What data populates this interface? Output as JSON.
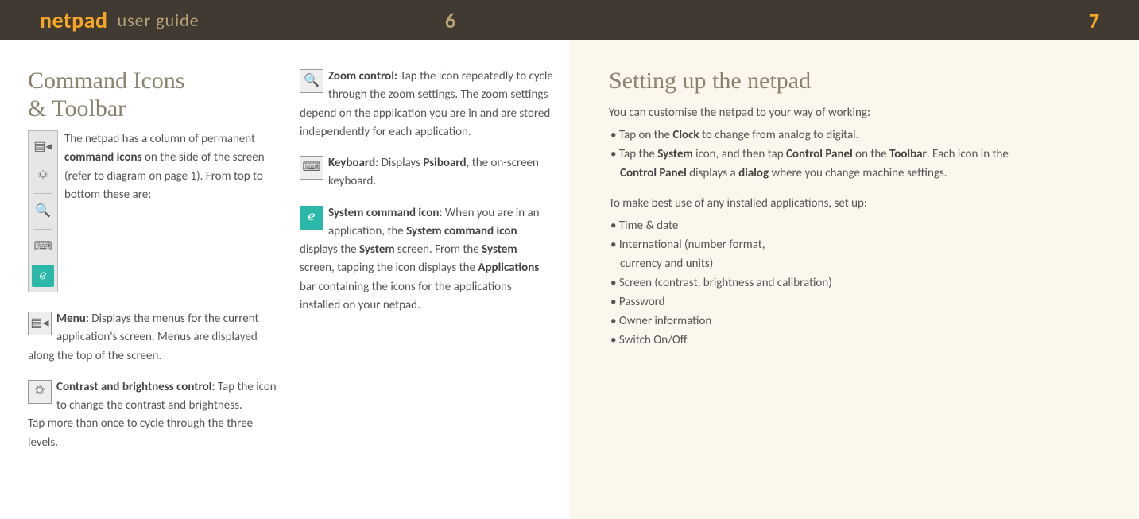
{
  "header": {
    "brand": "netpad",
    "guide": "user guide",
    "page_left": "6",
    "page_right": "7"
  },
  "left": {
    "title_line1": "Command Icons",
    "title_line2": "& Toolbar",
    "intro1": "The netpad has a column of permanent ",
    "intro_bold": "command icons",
    "intro2": " on the side of the screen (refer to diagram on page 1). From top to bottom these are:",
    "menu_label": "Menu:",
    "menu_text": " Displays the menus for the current application's screen. Menus are displayed along the top of the screen.",
    "contrast_label": "Contrast and brightness control:",
    "contrast_text": " Tap the icon to change the contrast and brightness.",
    "contrast_text2": "Tap more than once to cycle through the three levels.",
    "zoom_label": "Zoom control:",
    "zoom_text": "  Tap the icon repeatedly to cycle through the zoom settings.  The zoom settings depend on the application you are in and are stored independently for each application.",
    "keyboard_label": "Keyboard:",
    "keyboard_text1": " Displays ",
    "keyboard_bold": "Psiboard",
    "keyboard_text2": ", the on-screen keyboard.",
    "sys_label": "System command icon:",
    "sys_text1": "  When you are in an application, the ",
    "sys_bold1": "System command icon",
    "sys_text2": " displays the ",
    "sys_bold2": "System",
    "sys_text3": " screen. From the ",
    "sys_bold3": "System",
    "sys_text4": " screen, tapping the icon displays the ",
    "sys_bold4": "Applications",
    "sys_text5": " bar containing the icons for the applications installed on your netpad."
  },
  "right": {
    "title": "Setting up the netpad",
    "intro": "You can customise the netpad to your way of working:",
    "b1a": "Tap on the ",
    "b1b": "Clock",
    "b1c": " to change from analog to digital.",
    "b2a": "Tap the ",
    "b2b": "System",
    "b2c": " icon, and then tap ",
    "b2d": "Control Panel",
    "b2e": " on the ",
    "b2f": "Toolbar",
    "b2g": ". Each icon in the ",
    "b2h": "Control Panel",
    "b2i": " displays a ",
    "b2j": "dialog",
    "b2k": " where you change machine settings.",
    "setup_intro": "To make best use of any installed applications, set up:",
    "s1": "Time & date",
    "s2a": "International (number format,",
    "s2b": "currency and units)",
    "s3": "Screen (contrast, brightness and calibration)",
    "s4": "Password",
    "s5": "Owner information",
    "s6": "Switch On/Off"
  }
}
